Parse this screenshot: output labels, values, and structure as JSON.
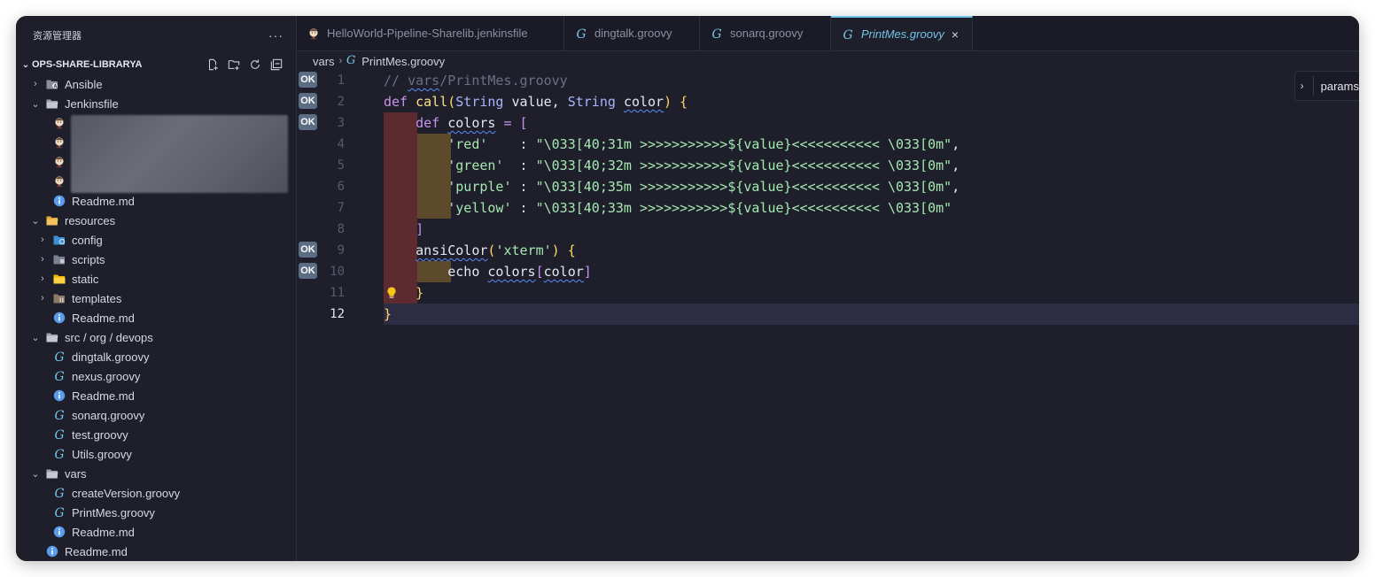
{
  "sidebar": {
    "title": "资源管理器",
    "more": "···",
    "project": "OPS-SHARE-LIBRARYA",
    "tree": [
      {
        "id": "ansible",
        "label": "Ansible",
        "depth": 1,
        "kind": "folder",
        "chev": "›",
        "icon": "ansible-folder-icon"
      },
      {
        "id": "jenkinsfile",
        "label": "Jenkinsfile",
        "depth": 1,
        "kind": "folder",
        "chev": "⌄",
        "icon": "folder-open-icon"
      },
      {
        "id": "jf1",
        "label": "",
        "depth": 2,
        "kind": "file",
        "icon": "jenkins-icon"
      },
      {
        "id": "jf2",
        "label": "",
        "depth": 2,
        "kind": "file",
        "icon": "jenkins-icon"
      },
      {
        "id": "jf3",
        "label": "",
        "depth": 2,
        "kind": "file",
        "icon": "jenkins-icon"
      },
      {
        "id": "jf4",
        "label": "",
        "depth": 2,
        "kind": "file",
        "icon": "jenkins-icon"
      },
      {
        "id": "jf-readme",
        "label": "Readme.md",
        "depth": 2,
        "kind": "file",
        "icon": "info-icon"
      },
      {
        "id": "resources",
        "label": "resources",
        "depth": 1,
        "kind": "folder",
        "chev": "⌄",
        "icon": "resources-folder-icon"
      },
      {
        "id": "config",
        "label": "config",
        "depth": 2,
        "kind": "folder",
        "chev": "›",
        "icon": "config-folder-icon"
      },
      {
        "id": "scripts",
        "label": "scripts",
        "depth": 2,
        "kind": "folder",
        "chev": "›",
        "icon": "scripts-folder-icon"
      },
      {
        "id": "static",
        "label": "static",
        "depth": 2,
        "kind": "folder",
        "chev": "›",
        "icon": "static-folder-icon"
      },
      {
        "id": "templates",
        "label": "templates",
        "depth": 2,
        "kind": "folder",
        "chev": "›",
        "icon": "templates-folder-icon"
      },
      {
        "id": "res-readme",
        "label": "Readme.md",
        "depth": 2,
        "kind": "file",
        "icon": "info-icon"
      },
      {
        "id": "src",
        "label": "src / org / devops",
        "depth": 1,
        "kind": "folder",
        "chev": "⌄",
        "icon": "folder-open-icon"
      },
      {
        "id": "dingtalk",
        "label": "dingtalk.groovy",
        "depth": 2,
        "kind": "file",
        "icon": "groovy-icon"
      },
      {
        "id": "nexus",
        "label": "nexus.groovy",
        "depth": 2,
        "kind": "file",
        "icon": "groovy-icon"
      },
      {
        "id": "src-readme",
        "label": "Readme.md",
        "depth": 2,
        "kind": "file",
        "icon": "info-icon"
      },
      {
        "id": "sonarq",
        "label": "sonarq.groovy",
        "depth": 2,
        "kind": "file",
        "icon": "groovy-icon"
      },
      {
        "id": "test",
        "label": "test.groovy",
        "depth": 2,
        "kind": "file",
        "icon": "groovy-icon"
      },
      {
        "id": "utils",
        "label": "Utils.groovy",
        "depth": 2,
        "kind": "file",
        "icon": "groovy-icon"
      },
      {
        "id": "vars",
        "label": "vars",
        "depth": 1,
        "kind": "folder",
        "chev": "⌄",
        "icon": "folder-open-icon"
      },
      {
        "id": "createversion",
        "label": "createVersion.groovy",
        "depth": 2,
        "kind": "file",
        "icon": "groovy-icon"
      },
      {
        "id": "printmes",
        "label": "PrintMes.groovy",
        "depth": 2,
        "kind": "file",
        "icon": "groovy-icon"
      },
      {
        "id": "vars-readme",
        "label": "Readme.md",
        "depth": 2,
        "kind": "file",
        "icon": "info-icon"
      },
      {
        "id": "root-readme",
        "label": "Readme.md",
        "depth": 1,
        "kind": "file",
        "icon": "info-icon"
      }
    ]
  },
  "tabs": [
    {
      "label": "HelloWorld-Pipeline-Sharelib.jenkinsfile",
      "icon": "jenkins-icon",
      "active": false
    },
    {
      "label": "dingtalk.groovy",
      "icon": "groovy-icon",
      "active": false
    },
    {
      "label": "sonarq.groovy",
      "icon": "groovy-icon",
      "active": false
    },
    {
      "label": "PrintMes.groovy",
      "icon": "groovy-icon",
      "active": true,
      "close": "×"
    }
  ],
  "breadcrumb": {
    "folder": "vars",
    "file": "PrintMes.groovy"
  },
  "outline": {
    "label": "params"
  },
  "code": {
    "ok_label": "OK",
    "ok_lines": [
      1,
      2,
      3,
      9,
      10
    ],
    "current_line": 12,
    "lines": [
      "// vars/PrintMes.groovy",
      "def call(String value, String color) {",
      "    def colors = [",
      "        'red'    : \"\\033[40;31m >>>>>>>>>>>${value}<<<<<<<<<<< \\033[0m\",",
      "        'green'  : \"\\033[40;32m >>>>>>>>>>>${value}<<<<<<<<<<< \\033[0m\",",
      "        'purple' : \"\\033[40;35m >>>>>>>>>>>${value}<<<<<<<<<<< \\033[0m\",",
      "        'yellow' : \"\\033[40;33m >>>>>>>>>>>${value}<<<<<<<<<<< \\033[0m\"",
      "    ]",
      "    ansiColor('xterm') {",
      "        echo colors[color]",
      "    }",
      "}"
    ]
  },
  "colors": {
    "background": "#1e1f2b",
    "accent": "#74c5e8",
    "keyword": "#c792ea",
    "string": "#a5e8b0",
    "function": "#ffe089",
    "type": "#a9b4ff"
  }
}
